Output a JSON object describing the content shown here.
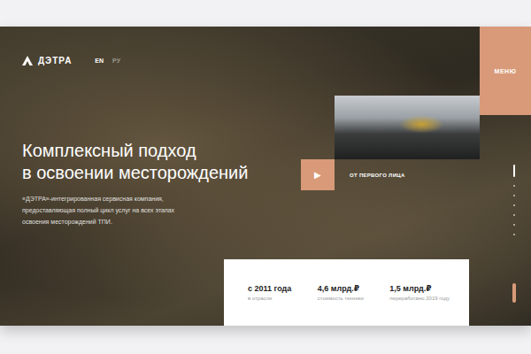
{
  "header": {
    "logo": "ДЭТРА",
    "languages": [
      {
        "label": "EN",
        "selected": true
      },
      {
        "label": "РУ",
        "selected": false
      }
    ],
    "menu": "МЕНЮ"
  },
  "hero": {
    "headline": [
      "Комплексный подход",
      "в освоении месторождений"
    ],
    "description": "«ДЭТРА»-интегрированная сервисная компания, предоставляющая полный цикл услуг на всех этапах освоения месторождений ТПИ.",
    "play": "▶",
    "video_caption": "ОТ ПЕРВОГО ЛИЦА"
  },
  "pagination": [
    {
      "selected": true
    },
    {
      "selected": false
    },
    {
      "selected": false
    },
    {
      "selected": false
    },
    {
      "selected": false
    },
    {
      "selected": false
    },
    {
      "selected": false
    }
  ],
  "stats": [
    {
      "value": "с 2011 года",
      "label": "в отрасли"
    },
    {
      "value": "4,6 млрд.₽",
      "label": "стоимость техники"
    },
    {
      "value": "1,5 млрд.₽",
      "label": "переработано 2019 году"
    }
  ]
}
